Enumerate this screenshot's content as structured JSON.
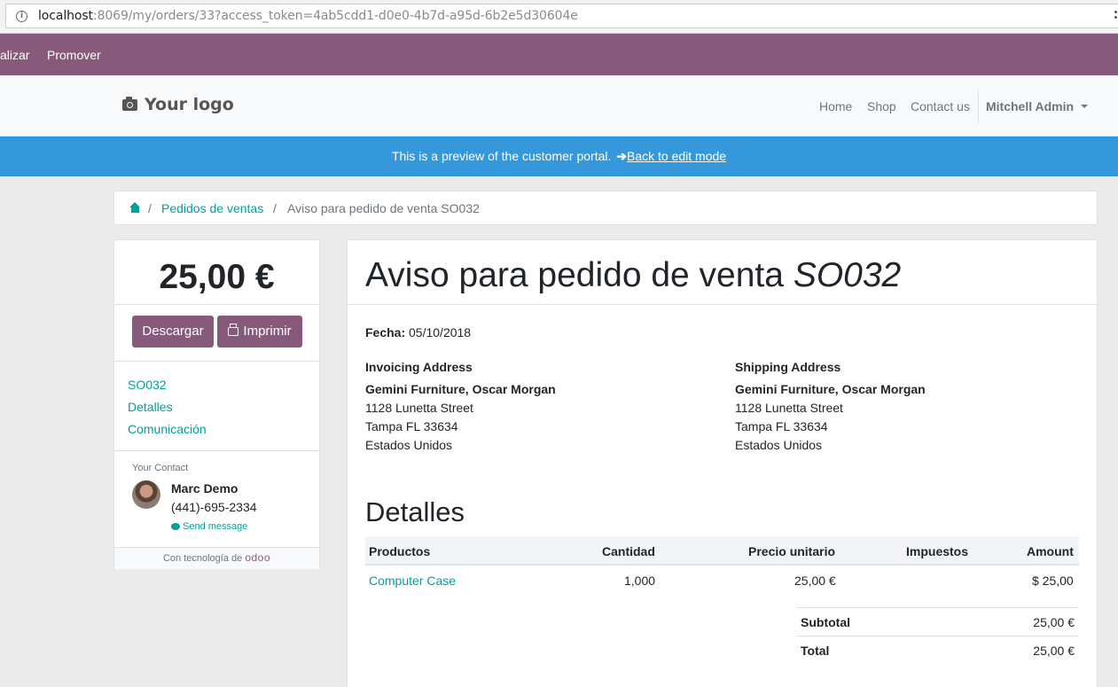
{
  "browser": {
    "url_host": "localhost",
    "url_rest": ":8069/my/orders/33?access_token=4ab5cdd1-d0e0-4b7d-a95d-6b2e5d30604e"
  },
  "odoo_bar": {
    "items": [
      "alizar",
      "Promover"
    ]
  },
  "header": {
    "logo_text": "Your logo",
    "nav": [
      "Home",
      "Shop",
      "Contact us"
    ],
    "user": "Mitchell Admin"
  },
  "banner": {
    "text": "This is a preview of the customer portal.",
    "link": "Back to edit mode",
    "color": "#3498db"
  },
  "breadcrumb": {
    "link": "Pedidos de ventas",
    "current": "Aviso para pedido de venta SO032"
  },
  "sidebar": {
    "amount": "25,00 €",
    "download_label": "Descargar",
    "print_label": "Imprimir",
    "links": [
      "SO032",
      "Detalles",
      "Comunicación"
    ],
    "contact_label": "Your Contact",
    "contact_name": "Marc Demo",
    "contact_phone": "(441)-695-2334",
    "send_message": "Send message",
    "powered_by": "Con tecnología de",
    "powered_brand": "odoo"
  },
  "document": {
    "title_prefix": "Aviso para pedido de venta",
    "title_ref": "SO032",
    "date_label": "Fecha:",
    "date_value": "05/10/2018",
    "invoicing": {
      "heading": "Invoicing Address",
      "name": "Gemini Furniture, Oscar Morgan",
      "line1": "1128 Lunetta Street",
      "line2": "Tampa FL 33634",
      "line3": "Estados Unidos"
    },
    "shipping": {
      "heading": "Shipping Address",
      "name": "Gemini Furniture, Oscar Morgan",
      "line1": "1128 Lunetta Street",
      "line2": "Tampa FL 33634",
      "line3": "Estados Unidos"
    },
    "details_title": "Detalles",
    "table": {
      "headers": [
        "Productos",
        "Cantidad",
        "Precio unitario",
        "Impuestos",
        "Amount"
      ],
      "rows": [
        {
          "product": "Computer Case",
          "qty": "1,000",
          "price": "25,00 €",
          "taxes": "",
          "amount": "$ 25,00"
        }
      ]
    },
    "subtotal_label": "Subtotal",
    "subtotal_value": "25,00 €",
    "total_label": "Total",
    "total_value": "25,00 €"
  },
  "colors": {
    "brand": "#875a7b",
    "link": "#00a09d"
  }
}
